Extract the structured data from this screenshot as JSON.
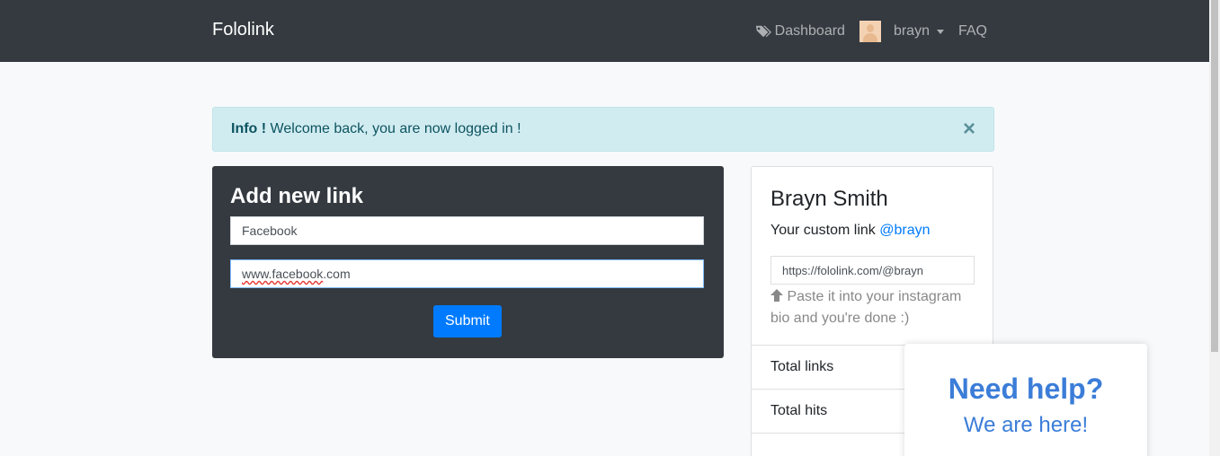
{
  "navbar": {
    "brand": "Fololink",
    "dashboard_label": "Dashboard",
    "username": "brayn",
    "faq_label": "FAQ"
  },
  "alert": {
    "strong": "Info !",
    "message": "Welcome back, you are now logged in !",
    "close_glyph": "×"
  },
  "add_link": {
    "title": "Add new link",
    "name_value": "Facebook",
    "url_prefix": "www.facebook",
    "url_suffix": ".com",
    "submit_label": "Submit"
  },
  "profile": {
    "name": "Brayn Smith",
    "custom_link_label": "Your custom link",
    "handle": "@brayn",
    "full_url": "https://fololink.com/@brayn",
    "hint": "Paste it into your instagram bio and you're done :)",
    "stats": [
      {
        "label": "Total links"
      },
      {
        "label": "Total hits"
      }
    ]
  },
  "help": {
    "title": "Need help?",
    "subtitle": "We are here!"
  },
  "colors": {
    "navbar_bg": "#343a40",
    "primary": "#007bff",
    "alert_bg": "#d1ecf1",
    "help_blue": "#3b7dd8"
  }
}
